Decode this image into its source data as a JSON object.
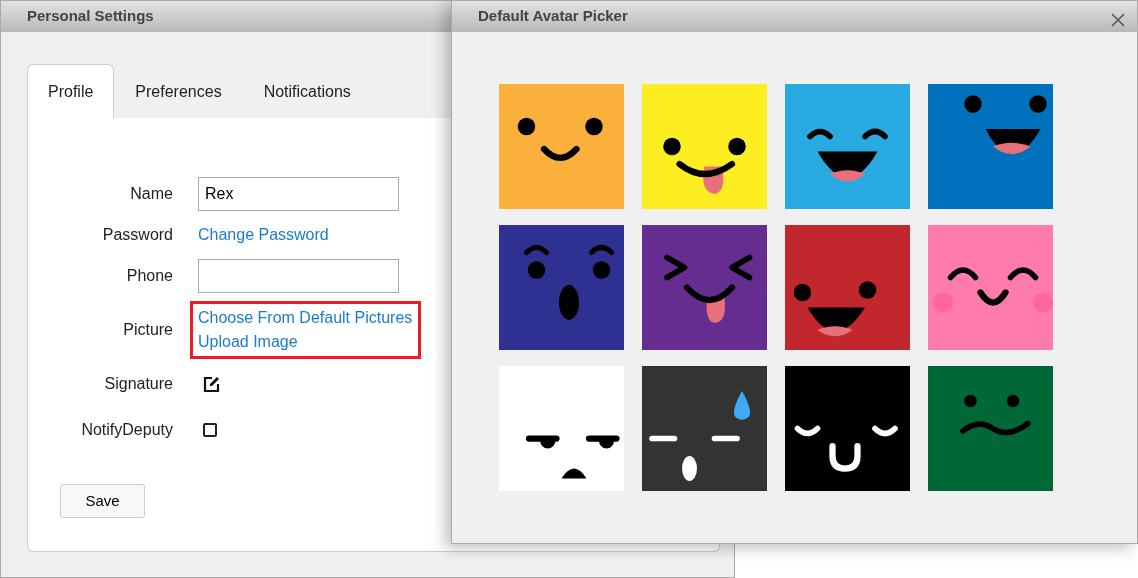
{
  "settings_window": {
    "title": "Personal Settings",
    "tabs": [
      {
        "label": "Profile",
        "selected": true
      },
      {
        "label": "Preferences",
        "selected": false
      },
      {
        "label": "Notifications",
        "selected": false
      }
    ],
    "fields": [
      {
        "kind": "text",
        "label": "Name",
        "value": "Rex"
      },
      {
        "kind": "links",
        "label": "Password",
        "links": [
          "Change Password"
        ],
        "highlighted": false
      },
      {
        "kind": "text",
        "label": "Phone"
      },
      {
        "kind": "links",
        "label": "Picture",
        "links": [
          "Choose From Default Pictures",
          "Upload Image"
        ],
        "highlighted": true
      },
      {
        "kind": "edit",
        "label": "Signature"
      },
      {
        "kind": "checkbox",
        "label": "NotifyDeputy",
        "checked": false
      }
    ],
    "save_button": "Save"
  },
  "avatar_picker": {
    "title": "Default Avatar Picker",
    "avatars": [
      {
        "kind": "smile",
        "color": "#fbb03b"
      },
      {
        "kind": "tongue",
        "color": "#fcee21"
      },
      {
        "kind": "grin",
        "color": "#29abe2"
      },
      {
        "kind": "laugh",
        "color": "#0071bc"
      },
      {
        "kind": "surprised",
        "color": "#2e3192"
      },
      {
        "kind": "squint",
        "color": "#662d91"
      },
      {
        "kind": "openmouth",
        "color": "#c1272d"
      },
      {
        "kind": "blush",
        "color": "#ff7bac"
      },
      {
        "kind": "grumpy",
        "color": "#ffffff"
      },
      {
        "kind": "sweat",
        "color": "#333333"
      },
      {
        "kind": "sleepy",
        "color": "#000000"
      },
      {
        "kind": "wavy",
        "color": "#006837"
      }
    ]
  }
}
